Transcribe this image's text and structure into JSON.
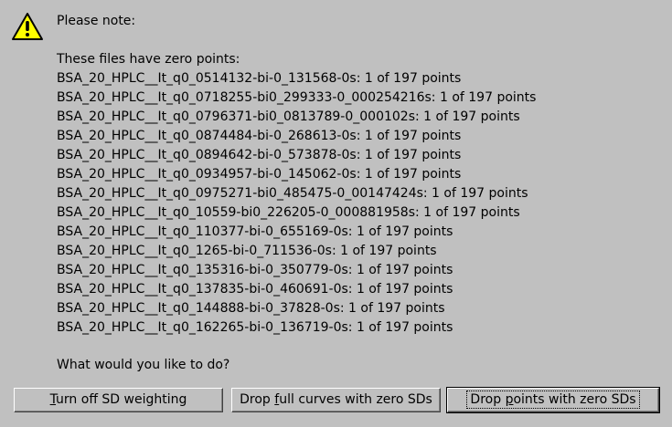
{
  "dialog": {
    "icon": "warning-icon",
    "title": "Please note:",
    "files_header": "These files have zero points:",
    "files": [
      "BSA_20_HPLC__It_q0_0514132-bi-0_131568-0s: 1 of 197 points",
      "BSA_20_HPLC__It_q0_0718255-bi0_299333-0_000254216s: 1 of 197 points",
      "BSA_20_HPLC__It_q0_0796371-bi0_0813789-0_000102s: 1 of 197 points",
      "BSA_20_HPLC__It_q0_0874484-bi-0_268613-0s: 1 of 197 points",
      "BSA_20_HPLC__It_q0_0894642-bi-0_573878-0s: 1 of 197 points",
      "BSA_20_HPLC__It_q0_0934957-bi-0_145062-0s: 1 of 197 points",
      "BSA_20_HPLC__It_q0_0975271-bi0_485475-0_00147424s: 1 of 197 points",
      "BSA_20_HPLC__It_q0_10559-bi0_226205-0_000881958s: 1 of 197 points",
      "BSA_20_HPLC__It_q0_110377-bi-0_655169-0s: 1 of 197 points",
      "BSA_20_HPLC__It_q0_1265-bi-0_711536-0s: 1 of 197 points",
      "BSA_20_HPLC__It_q0_135316-bi-0_350779-0s: 1 of 197 points",
      "BSA_20_HPLC__It_q0_137835-bi-0_460691-0s: 1 of 197 points",
      "BSA_20_HPLC__It_q0_144888-bi-0_37828-0s: 1 of 197 points",
      "BSA_20_HPLC__It_q0_162265-bi-0_136719-0s: 1 of 197 points"
    ],
    "question": "What would you like to do?"
  },
  "buttons": {
    "turn_off": {
      "pre": "",
      "mnemonic": "T",
      "post": "urn off SD weighting"
    },
    "drop_curves": {
      "pre": "Drop ",
      "mnemonic": "f",
      "post": "ull curves with zero SDs"
    },
    "drop_points": {
      "pre": "Drop ",
      "mnemonic": "p",
      "post": "oints with zero SDs"
    }
  },
  "colors": {
    "background": "#c0c0c0",
    "warning_fill": "#ffff00",
    "warning_outline": "#000000"
  }
}
